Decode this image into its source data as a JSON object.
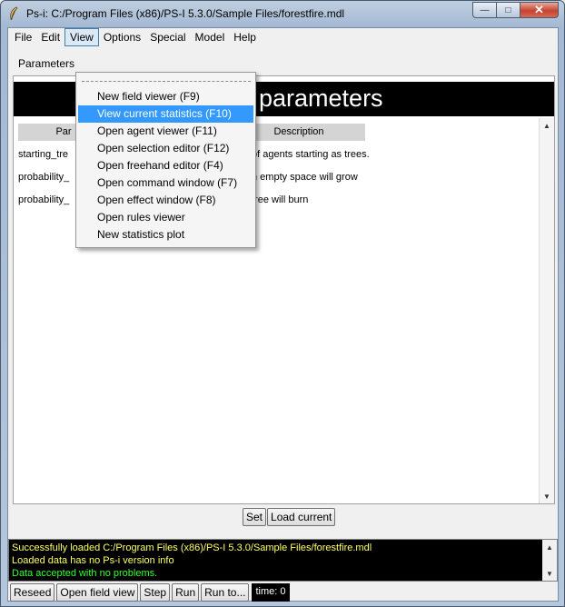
{
  "window": {
    "title": "Ps-i: C:/Program Files (x86)/PS-I 5.3.0/Sample Files/forestfire.mdl",
    "minimize_glyph": "—",
    "maximize_glyph": "□",
    "close_glyph": "✕"
  },
  "menubar": {
    "items": [
      "File",
      "Edit",
      "View",
      "Options",
      "Special",
      "Model",
      "Help"
    ],
    "open_item": "View"
  },
  "view_menu": {
    "items": [
      "New field viewer (F9)",
      "View current statistics (F10)",
      "Open agent viewer (F11)",
      "Open selection editor (F12)",
      "Open freehand editor (F4)",
      "Open command window (F7)",
      "Open effect window (F8)",
      "Open rules viewer",
      "New statistics plot"
    ],
    "highlighted_index": 1
  },
  "panel": {
    "label": "Parameters",
    "banner_title": "parameters",
    "columns": [
      "Par",
      "Description"
    ],
    "rows": [
      {
        "name": "starting_tre",
        "description": "of agents starting as trees."
      },
      {
        "name": "probability_",
        "description": "n empty space will grow"
      },
      {
        "name": "probability_",
        "description": "tree will burn"
      }
    ]
  },
  "buttons": {
    "set": "Set",
    "load_current": "Load current"
  },
  "console": {
    "lines": [
      {
        "text": "Successfully loaded C:/Program Files (x86)/PS-I 5.3.0/Sample Files/forestfire.mdl",
        "color": "#ffff66"
      },
      {
        "text": "Loaded data has no Ps-i version info",
        "color": "#ffff66"
      },
      {
        "text": "Data accepted with no problems.",
        "color": "#33ff33"
      }
    ]
  },
  "bottom_bar": {
    "reseed": "Reseed",
    "open_field_view": "Open field view",
    "step": "Step",
    "run": "Run",
    "run_to": "Run to...",
    "time": "time: 0"
  }
}
